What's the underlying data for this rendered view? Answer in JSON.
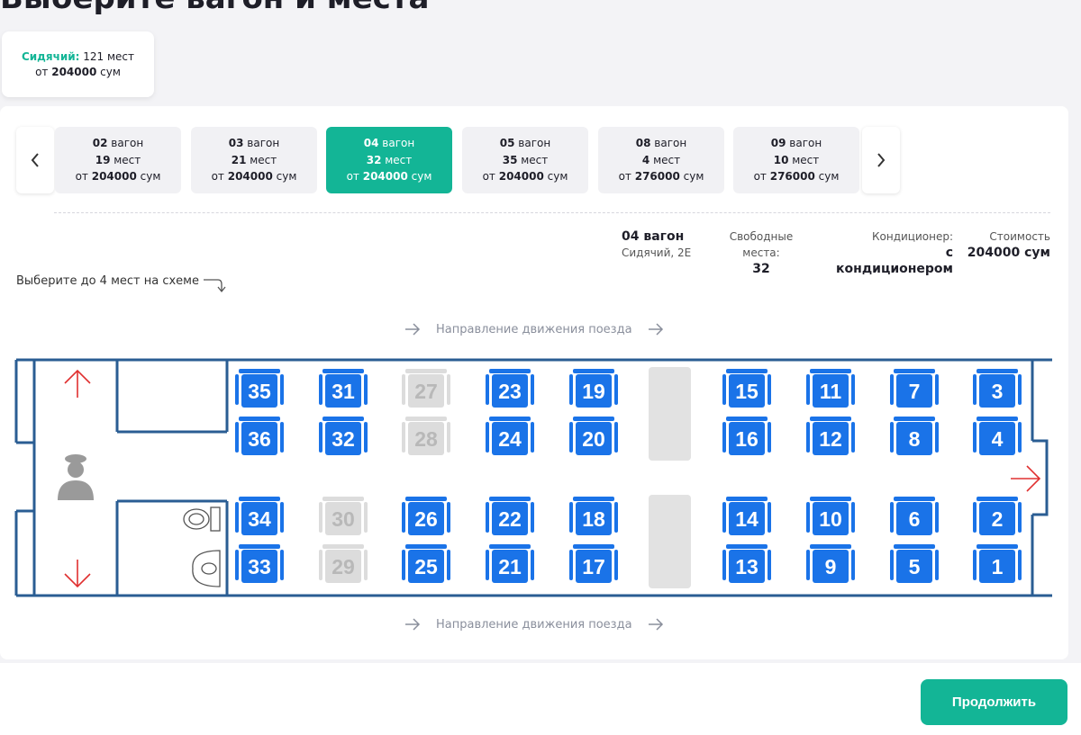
{
  "page_title": "Выберите вагон и места",
  "class_card": {
    "class_label": "Сидячий:",
    "seats": "121 мест",
    "price_prefix": "от",
    "price": "204000",
    "currency": "сум"
  },
  "car_tabs": [
    {
      "num": "02",
      "car_word": "вагон",
      "seats_num": "19",
      "seats_word": "мест",
      "price_prefix": "от",
      "price": "204000",
      "currency": "сум",
      "active": false
    },
    {
      "num": "03",
      "car_word": "вагон",
      "seats_num": "21",
      "seats_word": "мест",
      "price_prefix": "от",
      "price": "204000",
      "currency": "сум",
      "active": false
    },
    {
      "num": "04",
      "car_word": "вагон",
      "seats_num": "32",
      "seats_word": "мест",
      "price_prefix": "от",
      "price": "204000",
      "currency": "сум",
      "active": true
    },
    {
      "num": "05",
      "car_word": "вагон",
      "seats_num": "35",
      "seats_word": "мест",
      "price_prefix": "от",
      "price": "204000",
      "currency": "сум",
      "active": false
    },
    {
      "num": "08",
      "car_word": "вагон",
      "seats_num": "4",
      "seats_word": "мест",
      "price_prefix": "от",
      "price": "276000",
      "currency": "сум",
      "active": false
    },
    {
      "num": "09",
      "car_word": "вагон",
      "seats_num": "10",
      "seats_word": "мест",
      "price_prefix": "от",
      "price": "276000",
      "currency": "сум",
      "active": false
    }
  ],
  "car_info": {
    "car_title": "04 вагон",
    "car_type": "Сидячий, 2Е",
    "free_label": "Свободные места:",
    "free_value": "32",
    "ac_label": "Кондиционер:",
    "ac_value": "с кондиционером",
    "cost_label": "Стоимость",
    "cost_value": "204000 сум"
  },
  "hint_text": "Выберите до 4 мест на схеме",
  "direction_text": "Направление движения поезда",
  "continue_label": "Продолжить",
  "colors": {
    "accent": "#13b596",
    "seat_free": "#1a73e8",
    "seat_taken": "#dcdcdc",
    "wall": "#2a5d93",
    "arrow": "#e03030"
  },
  "icons": {
    "prev": "chevron-left-icon",
    "next": "chevron-right-icon",
    "conductor": "conductor-icon",
    "toilet": "toilet-icon",
    "sink": "sink-icon"
  },
  "seats_top_row1": [
    {
      "n": "35",
      "free": true
    },
    {
      "n": "31",
      "free": true
    },
    {
      "n": "27",
      "free": false
    },
    {
      "n": "23",
      "free": true
    },
    {
      "n": "19",
      "free": true
    },
    {
      "n": "15",
      "free": true
    },
    {
      "n": "11",
      "free": true
    },
    {
      "n": "7",
      "free": true
    },
    {
      "n": "3",
      "free": true
    }
  ],
  "seats_top_row2": [
    {
      "n": "36",
      "free": true
    },
    {
      "n": "32",
      "free": true
    },
    {
      "n": "28",
      "free": false
    },
    {
      "n": "24",
      "free": true
    },
    {
      "n": "20",
      "free": true
    },
    {
      "n": "16",
      "free": true
    },
    {
      "n": "12",
      "free": true
    },
    {
      "n": "8",
      "free": true
    },
    {
      "n": "4",
      "free": true
    }
  ],
  "seats_bot_row1": [
    {
      "n": "34",
      "free": true
    },
    {
      "n": "30",
      "free": false
    },
    {
      "n": "26",
      "free": true
    },
    {
      "n": "22",
      "free": true
    },
    {
      "n": "18",
      "free": true
    },
    {
      "n": "14",
      "free": true
    },
    {
      "n": "10",
      "free": true
    },
    {
      "n": "6",
      "free": true
    },
    {
      "n": "2",
      "free": true
    }
  ],
  "seats_bot_row2": [
    {
      "n": "33",
      "free": true
    },
    {
      "n": "29",
      "free": false
    },
    {
      "n": "25",
      "free": true
    },
    {
      "n": "21",
      "free": true
    },
    {
      "n": "17",
      "free": true
    },
    {
      "n": "13",
      "free": true
    },
    {
      "n": "9",
      "free": true
    },
    {
      "n": "5",
      "free": true
    },
    {
      "n": "1",
      "free": true
    }
  ]
}
